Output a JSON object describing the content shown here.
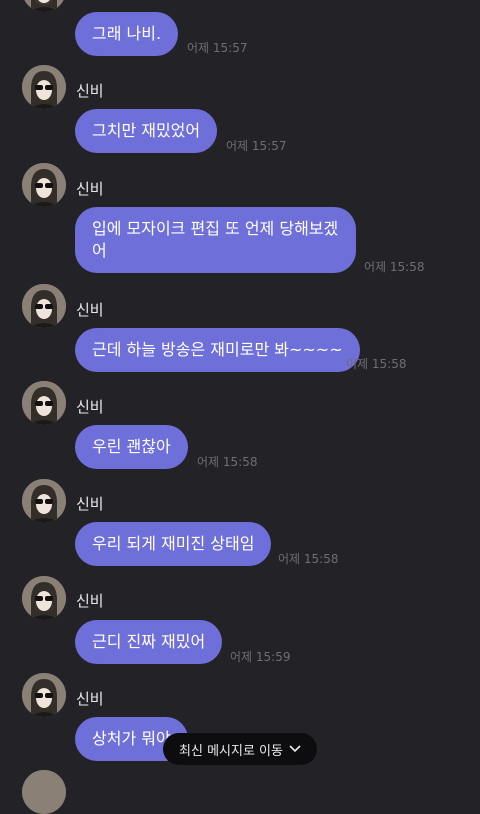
{
  "sender_name": "신비",
  "messages": [
    {
      "text": "그래 나비.",
      "time": "어제 15:57"
    },
    {
      "text": "그치만 재밌었어",
      "time": "어제 15:57"
    },
    {
      "text": "입에 모자이크 편집 또 언제 당해보겠어",
      "time": "어제 15:58"
    },
    {
      "text": "근데 하늘 방송은 재미로만 봐~~~~",
      "time": "어제 15:58"
    },
    {
      "text": "우린 괜찮아",
      "time": "어제 15:58"
    },
    {
      "text": "우리 되게 재미진 상태임",
      "time": "어제 15:58"
    },
    {
      "text": "근디 진짜 재밌어",
      "time": "어제 15:59"
    },
    {
      "text": "상처가 뭐야",
      "time": ""
    }
  ],
  "jump_button": {
    "label": "최신 메시지로 이동",
    "icon": "chevron-down-icon"
  },
  "colors": {
    "background": "#232327",
    "bubble": "#6e6fd8",
    "time": "#6d6d74"
  }
}
